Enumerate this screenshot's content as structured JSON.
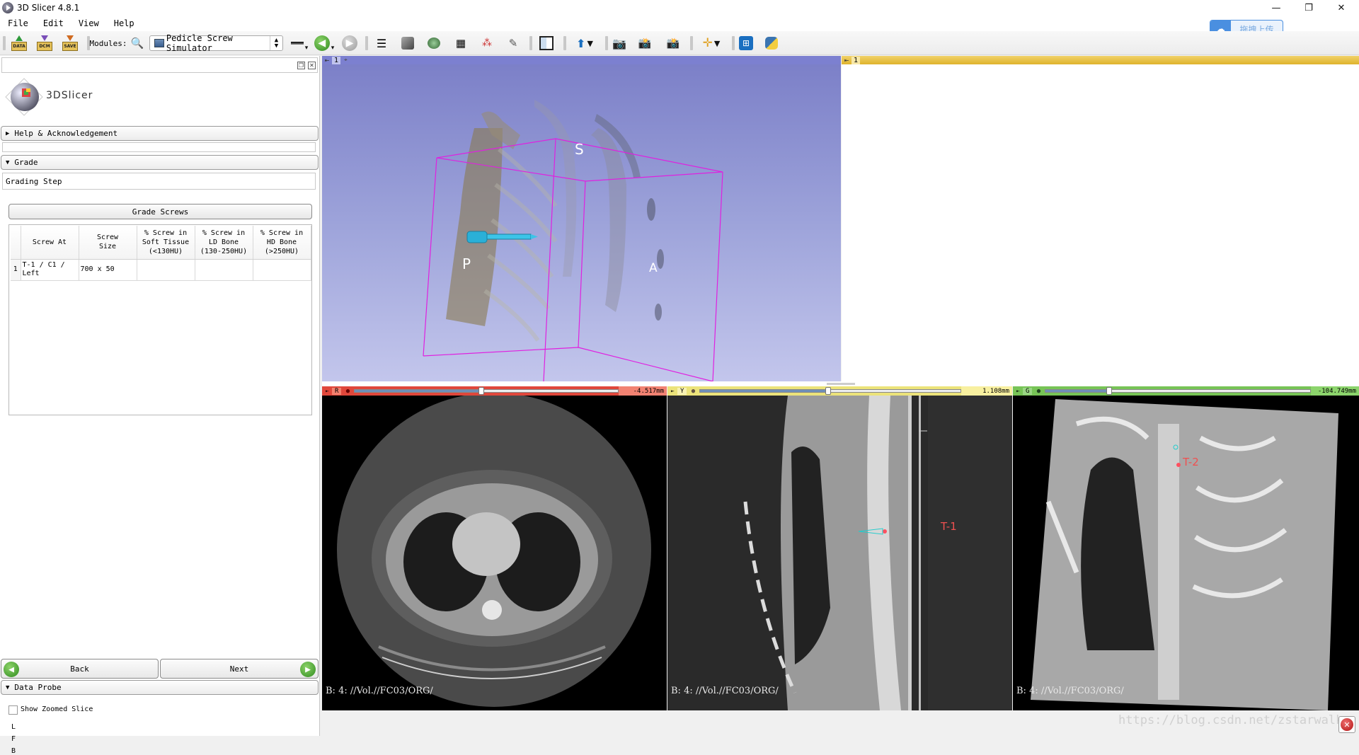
{
  "window": {
    "title": "3D Slicer 4.8.1",
    "controls": {
      "minimize": "—",
      "restore": "❐",
      "close": "✕"
    }
  },
  "menubar": {
    "items": [
      "File",
      "Edit",
      "View",
      "Help"
    ]
  },
  "toolbar": {
    "load_data_label": "DATA",
    "dicom_label": "DCM",
    "save_label": "SAVE",
    "modules_label": "Modules:",
    "module_selected": "Pedicle Screw Simulator",
    "icons": [
      "module-history-icon",
      "back-module-icon",
      "forward-module-icon",
      "data-module-icon",
      "volumes-icon",
      "models-icon",
      "transforms-icon",
      "markups-icon",
      "editor-icon",
      "layout-icon",
      "crosshair-icon",
      "screenshot-icon",
      "scene-view-icon",
      "scene-snapshot-icon",
      "fiducial-icon",
      "extension-manager-icon",
      "python-icon"
    ]
  },
  "baidu_upload": {
    "label": "拖拽上传"
  },
  "left_panel": {
    "logo_text": "3DSlicer",
    "sections": {
      "help": {
        "label": "Help & Acknowledgement",
        "expanded": false
      },
      "grade": {
        "label": "Grade",
        "expanded": true
      },
      "data_probe": {
        "label": "Data Probe",
        "expanded": true
      }
    },
    "step_title": "Grading Step",
    "grade_button": "Grade Screws",
    "table": {
      "headers": [
        "",
        "Screw At",
        "Screw\nSize",
        "% Screw in\nSoft Tissue\n(<130HU)",
        "% Screw in\nLD Bone\n(130-250HU)",
        "% Screw in\nHD Bone\n(>250HU)"
      ],
      "rows": [
        {
          "index": "1",
          "screw_at": "T-1 / C1 / Left",
          "screw_size": "700 x 50",
          "soft_tissue": "",
          "ld_bone": "",
          "hd_bone": ""
        }
      ]
    },
    "back_label": "Back",
    "next_label": "Next",
    "show_zoomed_slice": {
      "label": "Show Zoomed Slice",
      "checked": false
    },
    "probe_lines": [
      "L",
      "F",
      "B"
    ]
  },
  "views": {
    "view3d": {
      "label": "1",
      "orientation": {
        "superior": "S",
        "posterior": "P",
        "anterior": "A"
      },
      "bg_color": "#7c80c8",
      "bar_color": "#7c80c8"
    },
    "view_right": {
      "label": "1",
      "bar_color": "#e3b834"
    },
    "red": {
      "label": "R",
      "offset": "-4.517mm",
      "slider_fraction": 0.48,
      "bar_color": "#e0473b",
      "caption": "B: 4: //Vol.//FC03/ORG/"
    },
    "yellow": {
      "label": "Y",
      "offset": "1.108mm",
      "slider_fraction": 0.49,
      "bar_color": "#ece37a",
      "caption": "B: 4: //Vol.//FC03/ORG/",
      "marker": "T-1"
    },
    "green": {
      "label": "G",
      "offset": "-104.749mm",
      "slider_fraction": 0.24,
      "bar_color": "#77c456",
      "caption": "B: 4: //Vol.//FC03/ORG/",
      "marker": "T-2"
    }
  },
  "watermark": "https://blog.csdn.net/zstarwalk"
}
